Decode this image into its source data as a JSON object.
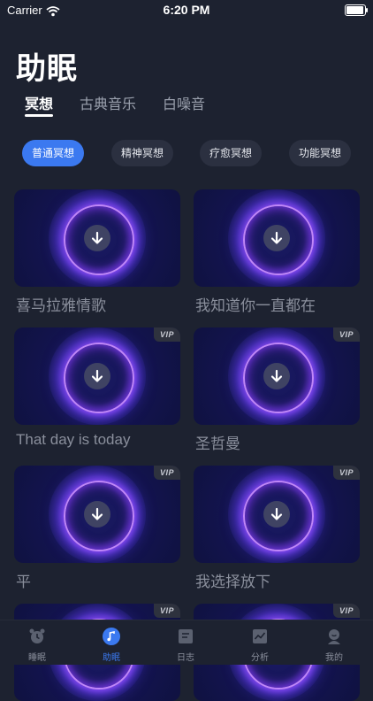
{
  "status_bar": {
    "carrier": "Carrier",
    "time": "6:20 PM"
  },
  "page": {
    "title": "助眠"
  },
  "tabs": [
    {
      "label": "冥想",
      "active": true
    },
    {
      "label": "古典音乐",
      "active": false
    },
    {
      "label": "白噪音",
      "active": false
    }
  ],
  "chips": [
    {
      "label": "普通冥想",
      "active": true
    },
    {
      "label": "精神冥想",
      "active": false
    },
    {
      "label": "疗愈冥想",
      "active": false
    },
    {
      "label": "功能冥想",
      "active": false
    }
  ],
  "cards": [
    {
      "title": "喜马拉雅情歌",
      "vip": false
    },
    {
      "title": "我知道你一直都在",
      "vip": false
    },
    {
      "title": "That day is today",
      "vip": true
    },
    {
      "title": "圣哲曼",
      "vip": true
    },
    {
      "title": "平",
      "vip": true
    },
    {
      "title": "我选择放下",
      "vip": true
    },
    {
      "title": "",
      "vip": true
    },
    {
      "title": "",
      "vip": true
    }
  ],
  "vip_badge": "VIP",
  "tabbar": [
    {
      "label": "睡眠",
      "icon": "alarm-clock-icon",
      "active": false
    },
    {
      "label": "助眠",
      "icon": "music-note-icon",
      "active": true
    },
    {
      "label": "日志",
      "icon": "journal-icon",
      "active": false
    },
    {
      "label": "分析",
      "icon": "chart-icon",
      "active": false
    },
    {
      "label": "我的",
      "icon": "profile-icon",
      "active": false
    }
  ],
  "colors": {
    "background": "#1d2230",
    "accent": "#3b79f0",
    "chip": "#2b3040",
    "card": "#141451"
  }
}
